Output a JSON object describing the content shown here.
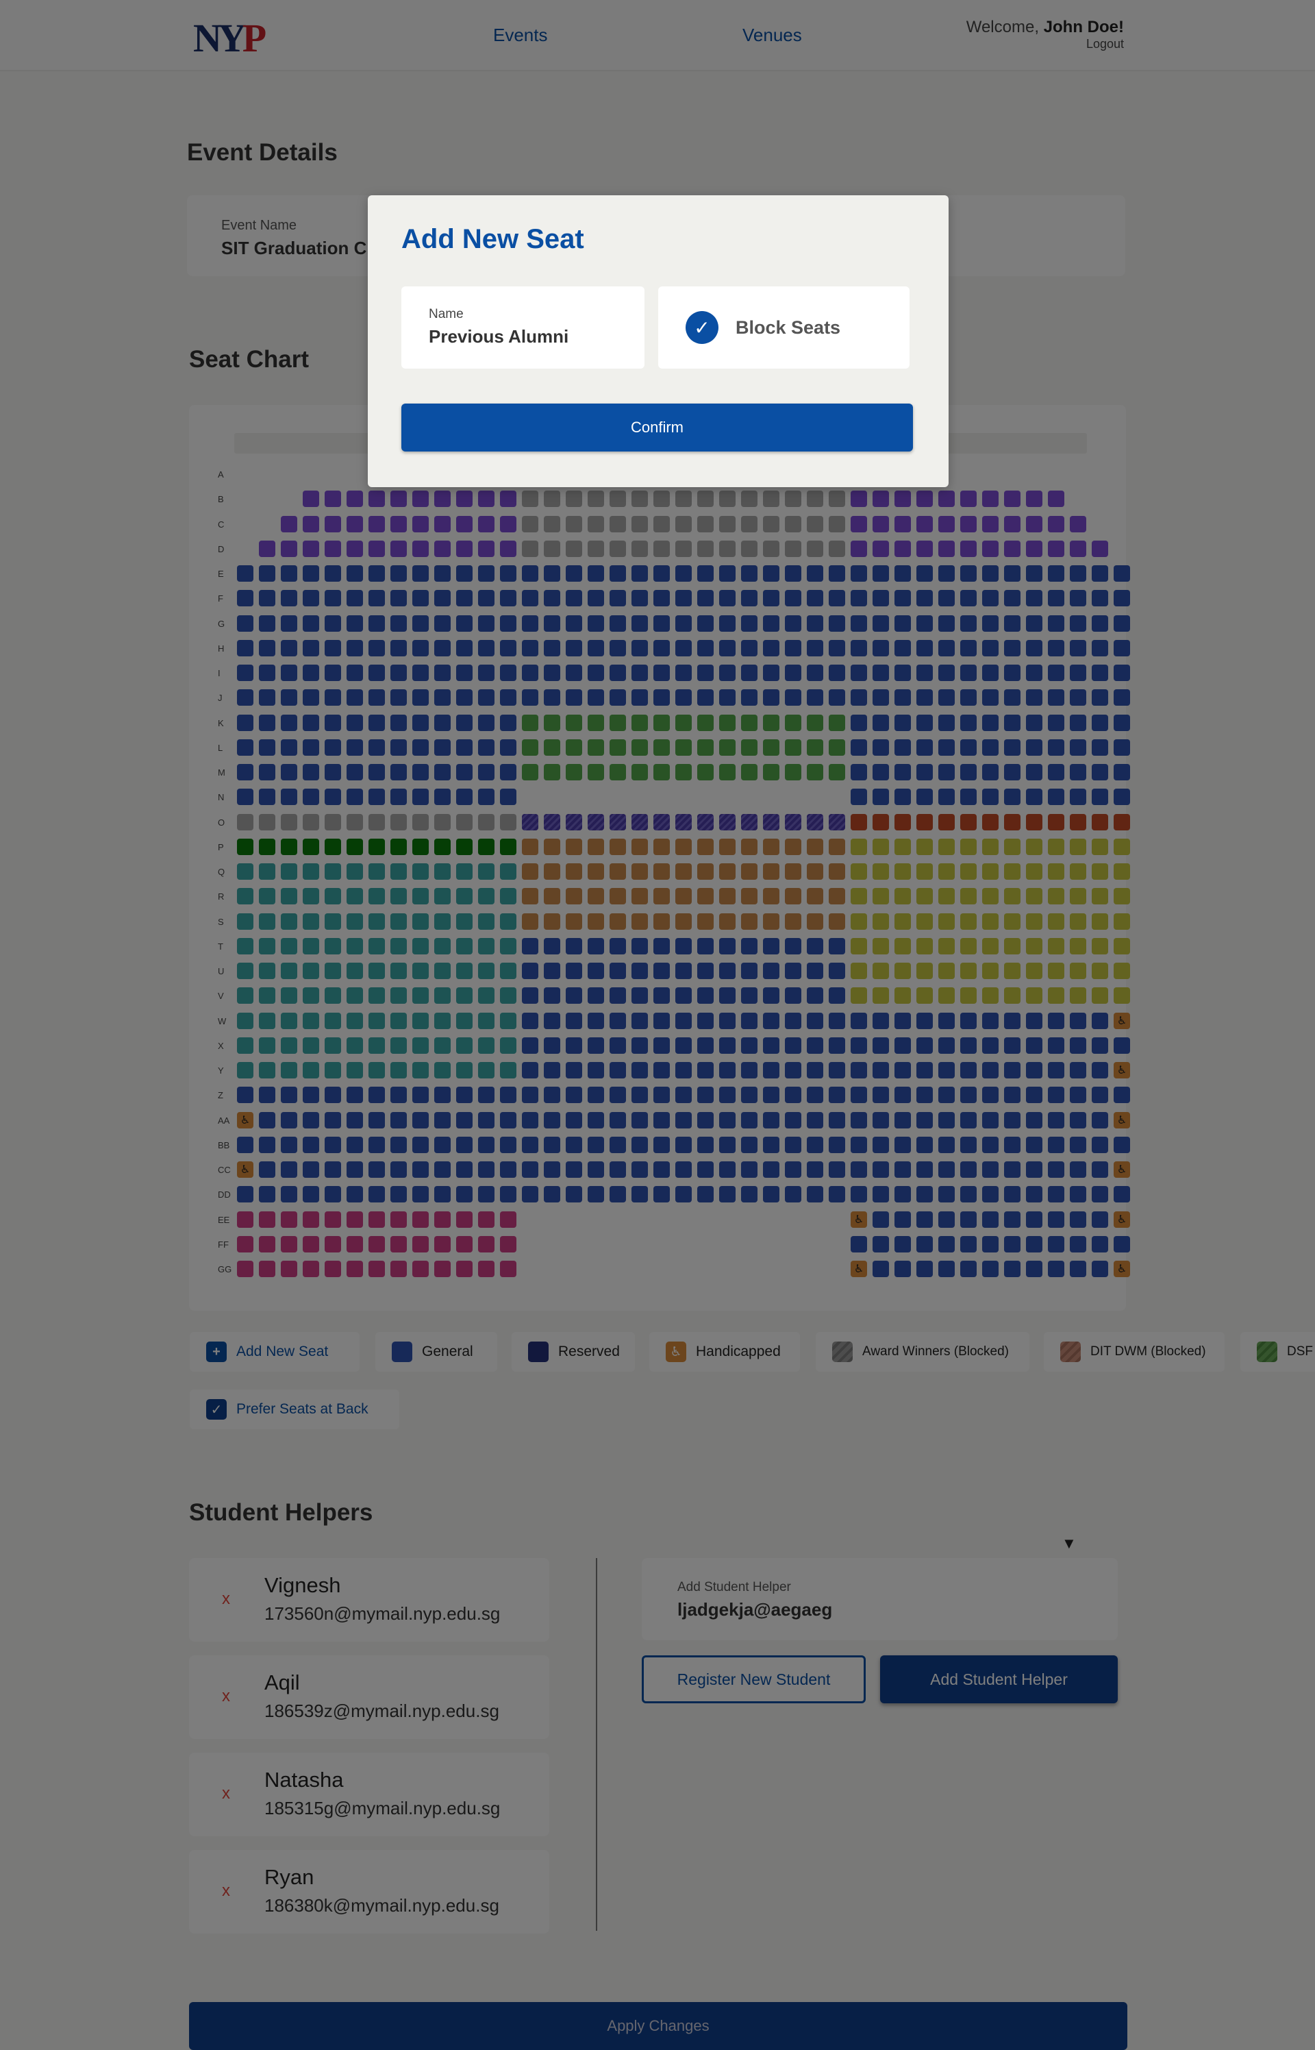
{
  "header": {
    "logo": {
      "n": "N",
      "y": "Y",
      "p": "P"
    },
    "nav": [
      "Events",
      "Venues"
    ],
    "welcome_prefix": "Welcome,",
    "user_name": "John Doe!",
    "logout": "Logout"
  },
  "event_details": {
    "title": "Event Details",
    "field_label": "Event Name",
    "field_value": "SIT Graduation C"
  },
  "seat_chart": {
    "title": "Seat Chart",
    "rows": [
      "A",
      "B",
      "C",
      "D",
      "E",
      "F",
      "G",
      "H",
      "I",
      "J",
      "K",
      "L",
      "M",
      "N",
      "O",
      "P",
      "Q",
      "R",
      "S",
      "T",
      "U",
      "V",
      "W",
      "X",
      "Y",
      "Z",
      "AA",
      "BB",
      "CC",
      "DD",
      "EE",
      "FF",
      "GG"
    ],
    "colors": {
      "general": "#2f52b0",
      "reserved": "#25307a",
      "purple": "#7c4cd6",
      "grey": "#a9a9a9",
      "green": "#53a64a",
      "darkgreen": "#0a7a0a",
      "hatch": "#4a3ca8",
      "red": "#c24a26",
      "teal": "#3aa6a6",
      "tan": "#c8894a",
      "olive": "#c6c641",
      "pink": "#cf3e86",
      "handicapped": "#d98a3a"
    }
  },
  "legend": {
    "add_new_seat": "Add New Seat",
    "items": [
      {
        "label": "General",
        "color": "#2f52b0"
      },
      {
        "label": "Reserved",
        "color": "#25307a"
      },
      {
        "label": "Handicapped",
        "color": "#d98a3a"
      },
      {
        "label": "Award Winners (Blocked)",
        "color": "#9a9a9a"
      },
      {
        "label": "DIT DWM (Blocked)",
        "color": "#c88c78"
      },
      {
        "label": "DSF D",
        "color": "#6aa85a"
      }
    ],
    "prefer_back": "Prefer Seats at Back"
  },
  "student_helpers": {
    "title": "Student Helpers",
    "remove_glyph": "x",
    "list": [
      {
        "name": "Vignesh",
        "email": "173560n@mymail.nyp.edu.sg"
      },
      {
        "name": "Aqil",
        "email": "186539z@mymail.nyp.edu.sg"
      },
      {
        "name": "Natasha",
        "email": "185315g@mymail.nyp.edu.sg"
      },
      {
        "name": "Ryan",
        "email": "186380k@mymail.nyp.edu.sg"
      }
    ],
    "add_label": "Add Student Helper",
    "add_value": "ljadgekja@aegaeg",
    "register_button": "Register New Student",
    "add_button": "Add Student Helper"
  },
  "apply_button": "Apply Changes",
  "modal": {
    "title": "Add New Seat",
    "name_label": "Name",
    "name_value": "Previous Alumni",
    "block_seats_label": "Block Seats",
    "block_seats_checked": true,
    "confirm_button": "Confirm"
  },
  "colors": {
    "primary": "#0a4fa3",
    "navy": "#0e3f8c",
    "remove": "#e0443a"
  }
}
